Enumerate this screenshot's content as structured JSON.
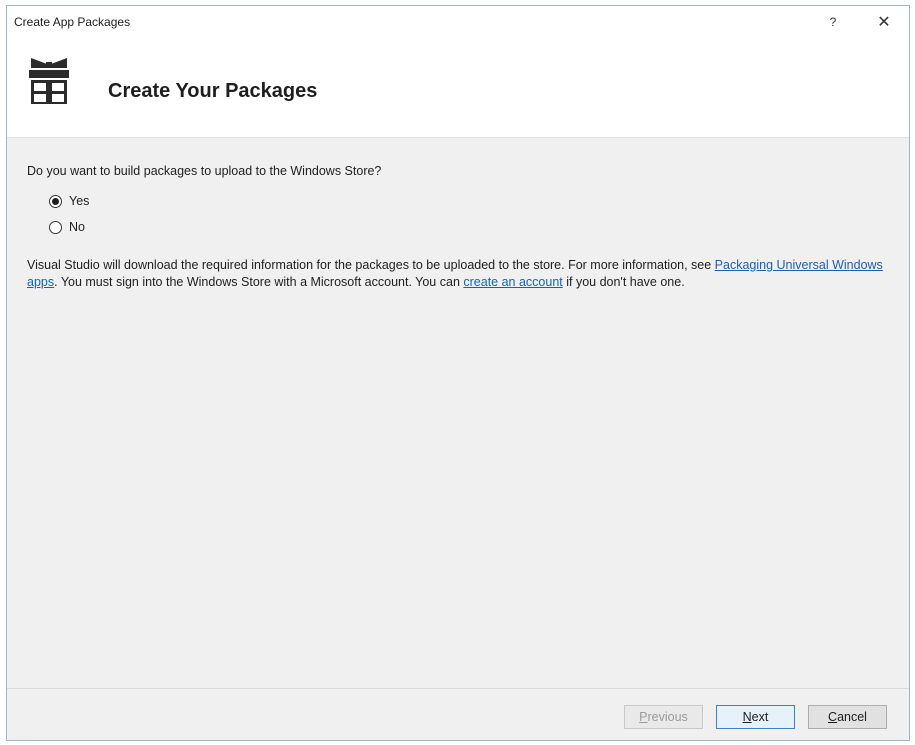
{
  "window": {
    "title": "Create App Packages",
    "help_glyph": "?",
    "close_glyph": "✕"
  },
  "banner": {
    "title": "Create Your Packages",
    "icon": "gift-box-icon"
  },
  "question": {
    "text": "Do you want to build packages to upload to the Windows Store?",
    "options": [
      {
        "label": "Yes",
        "selected": true
      },
      {
        "label": "No",
        "selected": false
      }
    ]
  },
  "info": {
    "part1": "Visual Studio will download the required information for the packages to be uploaded to the store. For more information, see ",
    "link1": "Packaging Universal Windows apps",
    "part2": ". You must sign into the Windows Store with a Microsoft account. You can ",
    "link2": "create an account",
    "part3": " if you don't have one."
  },
  "footer": {
    "previous": {
      "label": "Previous",
      "accesskey_char": "P",
      "rest": "revious",
      "enabled": false
    },
    "next": {
      "label": "Next",
      "accesskey_char": "N",
      "rest": "ext",
      "enabled": true
    },
    "cancel": {
      "label": "Cancel",
      "accesskey_char": "C",
      "rest": "ancel",
      "enabled": true
    }
  },
  "colors": {
    "link": "#1a5fb4",
    "window_border": "#9fb5c9",
    "dialog_bg": "#f0f0f0"
  }
}
